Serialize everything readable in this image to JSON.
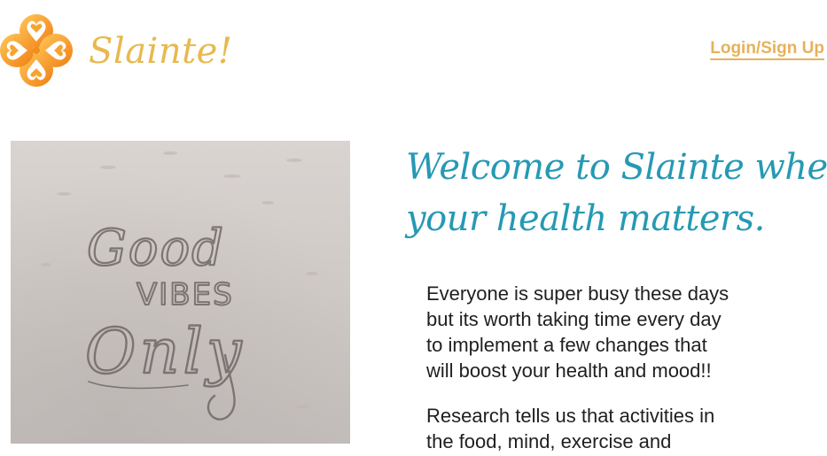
{
  "header": {
    "brand": "Slainte!",
    "login_label": "Login/Sign Up",
    "logo_icon": "clover-heart-logo-icon"
  },
  "hero": {
    "image": "sand-writing-photo",
    "sand_text": [
      "Good",
      "VIBES",
      "Only"
    ]
  },
  "welcome": {
    "heading_lines": [
      "Welcome to Slainte where",
      "your health matters."
    ]
  },
  "intro": {
    "paragraph1_lines": [
      "Everyone is super busy these days",
      "but its worth taking time every day",
      "to implement a few changes that",
      "will boost your health and mood!!"
    ],
    "paragraph2_lines": [
      "Research tells us that activities in",
      "the food, mind, exercise and"
    ]
  },
  "colors": {
    "brand_gold": "#e8b94e",
    "link_gold": "#e6b25a",
    "heading_teal": "#2699b4",
    "logo_orange": "#f28c1a",
    "body_text": "#1f1f1f"
  }
}
